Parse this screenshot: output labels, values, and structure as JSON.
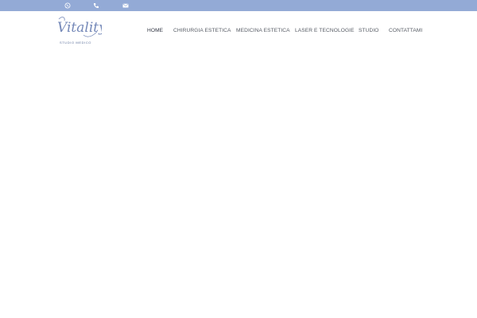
{
  "topbar": {
    "icons": [
      "whatsapp-icon",
      "phone-icon",
      "envelope-icon"
    ],
    "background": "#93aad6"
  },
  "logo": {
    "script_text": "Vitality",
    "tagline": "STUDIO MEDICO",
    "color": "#6e82b3"
  },
  "nav": {
    "items": [
      {
        "label": "HOME",
        "active": true
      },
      {
        "label": "CHIRURGIA ESTETICA",
        "active": false
      },
      {
        "label": "MEDICINA ESTETICA",
        "active": false
      },
      {
        "label": "LASER E TECNOLOGIE",
        "active": false
      },
      {
        "label": "STUDIO",
        "active": false
      },
      {
        "label": "CONTATTAMI",
        "active": false
      }
    ]
  }
}
